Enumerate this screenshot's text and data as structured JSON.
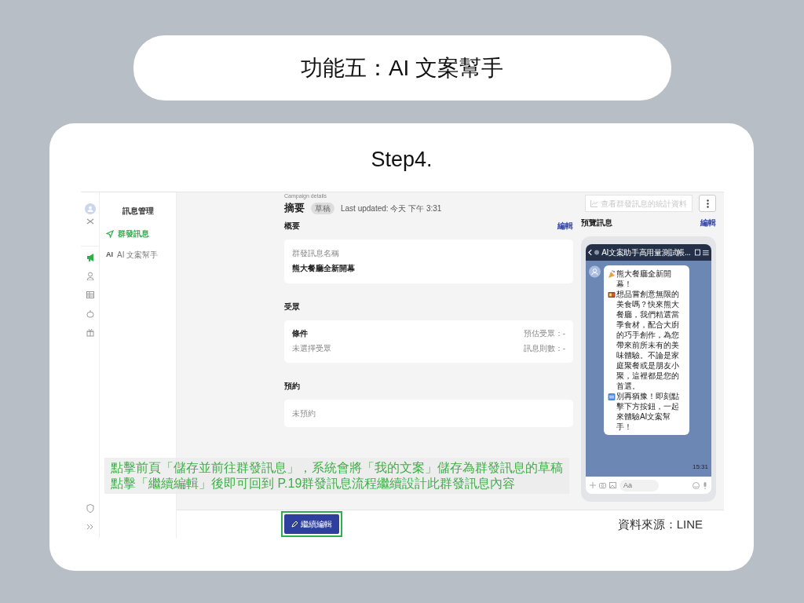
{
  "slide_title": "功能五：AI 文案幫手",
  "step": "Step4.",
  "app": {
    "rail_items": [
      {
        "selected": true
      },
      {
        "selected": false
      },
      {
        "selected": false
      },
      {
        "selected": false
      },
      {
        "selected": false
      }
    ],
    "sidebar": {
      "title": "訊息管理",
      "items": [
        {
          "kind": "send",
          "label": "群發訊息",
          "selected": true
        },
        {
          "kind": "glyph",
          "glyph": "AI",
          "label": "AI 文案幫手",
          "selected": false
        }
      ]
    },
    "header": {
      "breadcrumb": "Campaign details",
      "title": "摘要",
      "badge": "草稿",
      "updated": "Last updated: 今天 下午 3:31"
    },
    "stats_button": {
      "label": "查看群發訊息的統計資料",
      "disabled": true
    },
    "sections": [
      {
        "title": "概要",
        "edit": "編輯",
        "kind": "name",
        "label": "群發訊息名稱",
        "value": "熊大餐廳全新開幕"
      },
      {
        "title": "受眾",
        "kind": "audience",
        "left": [
          "條件",
          "未選擇受眾"
        ],
        "right": [
          "預估受眾：-",
          "訊息則數：-"
        ]
      },
      {
        "title": "預約",
        "kind": "plain",
        "text": "未預約"
      }
    ],
    "preview": {
      "title": "預覽訊息",
      "edit": "編輯",
      "chat_title": "AI文案助手高用量測試帳...",
      "time": "15:31",
      "input_placeholder": "Aa",
      "message": [
        {
          "kind": "party"
        },
        {
          "kind": "text",
          "text": "熊大餐廳全新開幕！"
        },
        {
          "kind": "bento"
        },
        {
          "kind": "text",
          "text": "想品嘗創意無限的美食嗎？快來熊大餐廳，我們精選當季食材，配合大廚的巧手創作，為您帶來前所未有的美味體驗。不論是家庭聚餐或是朋友小聚，這裡都是您的首選。"
        },
        {
          "kind": "free"
        },
        {
          "kind": "text",
          "text": "別再猶豫！即刻點擊下方按鈕，一起來體驗AI文案幫手！"
        }
      ]
    },
    "continue_button": "繼續編輯"
  },
  "annotation": [
    "點擊前頁「儲存並前往群發訊息」，系統會將「我的文案」儲存為群發訊息的草稿",
    "點擊「繼續編輯」後即可回到 P.19群發訊息流程繼續設計此群發訊息內容"
  ],
  "source": "資料來源：LINE"
}
